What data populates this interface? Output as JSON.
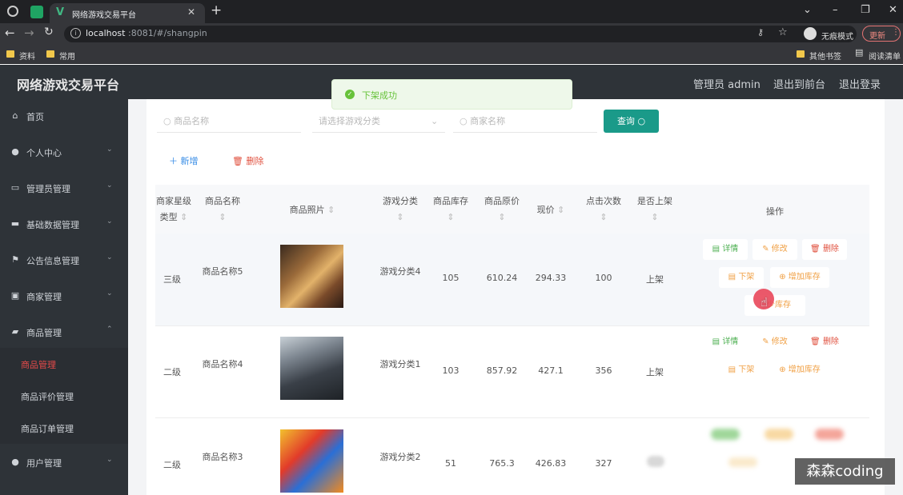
{
  "browser": {
    "tab_title": "网络游戏交易平台",
    "url_host": "localhost",
    "url_rest": ":8081/#/shangpin",
    "incognito_label": "无痕模式",
    "update_label": "更新",
    "bookmarks": [
      "资料",
      "常用"
    ],
    "other_bookmarks": "其他书签",
    "reading_list": "阅读清单"
  },
  "header": {
    "title": "网络游戏交易平台",
    "admin": "管理员 admin",
    "to_front": "退出到前台",
    "logout": "退出登录"
  },
  "toast": {
    "text": "下架成功"
  },
  "sidebar": {
    "items": [
      {
        "label": "首页",
        "icon": "home-icon"
      },
      {
        "label": "个人中心",
        "icon": "user-icon"
      },
      {
        "label": "管理员管理",
        "icon": "chat-icon"
      },
      {
        "label": "基础数据管理",
        "icon": "message-icon"
      },
      {
        "label": "公告信息管理",
        "icon": "flag-icon"
      },
      {
        "label": "商家管理",
        "icon": "shop-icon"
      },
      {
        "label": "商品管理",
        "icon": "briefcase-icon"
      }
    ],
    "sub_items": [
      "商品管理",
      "商品评价管理",
      "商品订单管理"
    ],
    "last_item": {
      "label": "用户管理",
      "icon": "user-icon"
    }
  },
  "search": {
    "name_placeholder": "商品名称",
    "category_placeholder": "请选择游戏分类",
    "merchant_placeholder": "商家名称",
    "query_label": "查询"
  },
  "actions": {
    "add_label": "新增",
    "delete_label": "删除"
  },
  "table": {
    "headers": [
      "商家星级类型",
      "商品名称",
      "商品照片",
      "游戏分类",
      "商品库存",
      "商品原价",
      "现价",
      "点击次数",
      "是否上架",
      "操作"
    ],
    "rows": [
      {
        "star": "三级",
        "name": "商品名称5",
        "category": "游戏分类4",
        "stock": "105",
        "price": "610.24",
        "now": "294.33",
        "clicks": "100",
        "on_shelf": "上架"
      },
      {
        "star": "二级",
        "name": "商品名称4",
        "category": "游戏分类1",
        "stock": "103",
        "price": "857.92",
        "now": "427.1",
        "clicks": "356",
        "on_shelf": "上架"
      },
      {
        "star": "二级",
        "name": "商品名称3",
        "category": "游戏分类2",
        "stock": "51",
        "price": "765.3",
        "now": "426.83",
        "clicks": "327",
        "on_shelf": ""
      }
    ],
    "op_labels": {
      "detail": "详情",
      "edit": "修改",
      "delete": "删除",
      "off_shelf": "下架",
      "add_stock": "增加库存",
      "reduce_stock": "减少库存",
      "reduce_stock_partial": "少库存"
    }
  },
  "watermark": "森森coding",
  "colors": {
    "primary": "#1a9a89",
    "sidebar": "#2e3338",
    "active_menu": "#e64a4a",
    "detail_green": "#4caf50",
    "edit_orange": "#f0a045",
    "delete_red": "#e0503e"
  }
}
